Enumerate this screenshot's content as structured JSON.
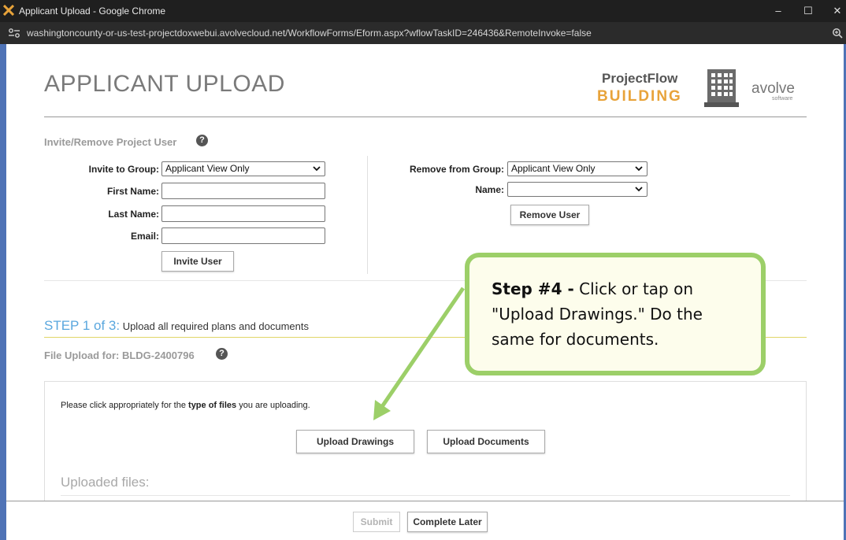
{
  "window": {
    "title": "Applicant Upload - Google Chrome",
    "url": "washingtoncounty-or-us-test-projectdoxwebui.avolvecloud.net/WorkflowForms/Eform.aspx?wflowTaskID=246436&RemoteInvoke=false",
    "minimize_glyph": "–",
    "maximize_glyph": "☐",
    "close_glyph": "✕"
  },
  "header": {
    "title": "APPLICANT UPLOAD",
    "brand_line1": "ProjectFlow",
    "brand_line2": "BUILDING",
    "vendor": "avolve",
    "vendor_sub": "software"
  },
  "invite_section": {
    "label": "Invite/Remove Project User",
    "help_glyph": "?",
    "invite_group_label": "Invite to Group:",
    "invite_group_value": "Applicant View Only",
    "first_name_label": "First Name:",
    "first_name_value": "",
    "last_name_label": "Last Name:",
    "last_name_value": "",
    "email_label": "Email:",
    "email_value": "",
    "invite_button": "Invite User",
    "remove_group_label": "Remove from Group:",
    "remove_group_value": "Applicant View Only",
    "name_label": "Name:",
    "name_value": "",
    "remove_button": "Remove User"
  },
  "step": {
    "number": "STEP 1 of 3:",
    "text": " Upload all required plans and documents",
    "file_upload_label": "File Upload for: BLDG-2400796",
    "help_glyph": "?"
  },
  "upload_panel": {
    "instruction_prefix": "Please click appropriately for the ",
    "instruction_bold": "type of files",
    "instruction_suffix": " you are uploading.",
    "upload_drawings": "Upload Drawings",
    "upload_documents": "Upload Documents",
    "uploaded_files_title": "Uploaded files:"
  },
  "footer": {
    "submit": "Submit",
    "complete_later": "Complete Later"
  },
  "callout": {
    "bold": "Step #4 -",
    "text": " Click or tap on \"Upload Drawings.\" Do the same for documents."
  },
  "colors": {
    "step_blue": "#5aa7de",
    "brand_orange": "#e8a33a",
    "callout_border": "#9ccf68",
    "callout_fill": "#fdfdec"
  }
}
